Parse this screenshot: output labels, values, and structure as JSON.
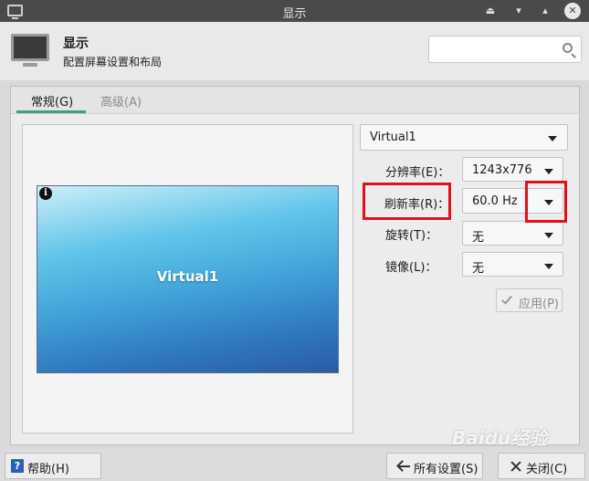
{
  "window": {
    "title": "显示"
  },
  "header": {
    "title": "显示",
    "subtitle": "配置屏幕设置和布局",
    "search_placeholder": ""
  },
  "tabs": [
    {
      "label": "常规(G)"
    },
    {
      "label": "高级(A)"
    }
  ],
  "preview": {
    "screen_label": "Virtual1",
    "info_symbol": "i"
  },
  "display_select": {
    "value": "Virtual1"
  },
  "settings": {
    "resolution": {
      "label": "分辨率(E)：",
      "value": "1243x776"
    },
    "refresh_rate": {
      "label": "刷新率(R)：",
      "value": "60.0 Hz"
    },
    "rotation": {
      "label": "旋转(T)：",
      "value": "无"
    },
    "reflection": {
      "label": "镜像(L)：",
      "value": "无"
    }
  },
  "apply_button": {
    "label": "应用(P)"
  },
  "footer": {
    "help_label": "帮助(H)",
    "help_symbol": "?",
    "all_settings_label": "所有设置(S)",
    "close_label": "关闭(C)"
  },
  "watermark": {
    "text": "Baidu经验"
  },
  "colors": {
    "accent": "#3a9e8c",
    "highlight": "#e0111b",
    "titlebar": "#4a4a4a"
  }
}
